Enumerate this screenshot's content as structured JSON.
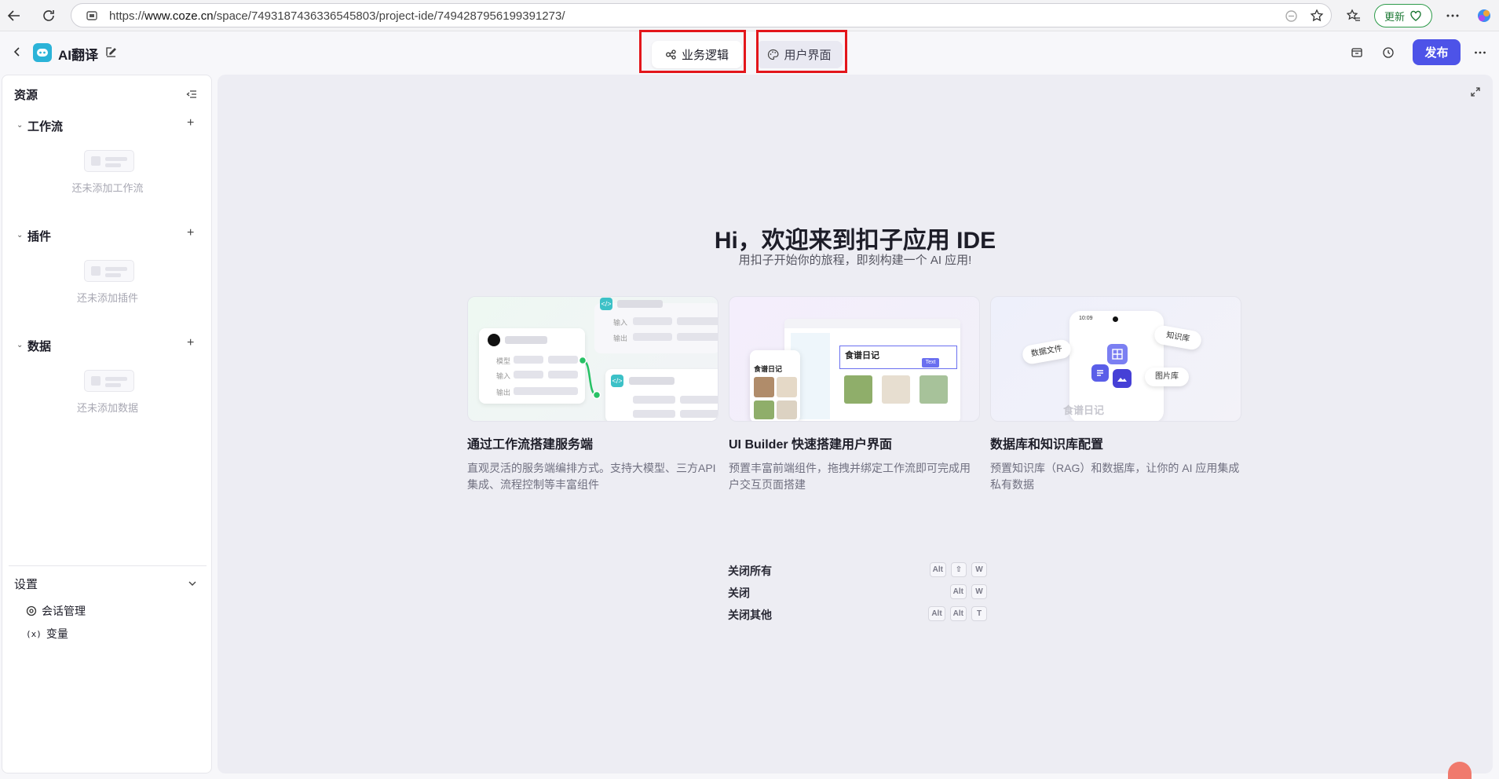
{
  "browser": {
    "url_prefix": "https://",
    "url_host": "www.coze.cn",
    "url_path": "/space/7493187436336545803/project-ide/7494287956199391273/",
    "update_label": "更新"
  },
  "header": {
    "app_title": "AI翻译",
    "tabs": [
      {
        "label": "业务逻辑",
        "active": true
      },
      {
        "label": "用户界面",
        "active": false
      }
    ],
    "publish_label": "发布"
  },
  "sidebar": {
    "title": "资源",
    "sections": [
      {
        "title": "工作流",
        "empty_text": "还未添加工作流"
      },
      {
        "title": "插件",
        "empty_text": "还未添加插件"
      },
      {
        "title": "数据",
        "empty_text": "还未添加数据"
      }
    ],
    "settings": {
      "title": "设置",
      "items": [
        {
          "label": "会话管理",
          "icon": "chat-settings-icon"
        },
        {
          "label": "变量",
          "icon": "variable-icon"
        }
      ]
    }
  },
  "main": {
    "welcome_title": "Hi，欢迎来到扣子应用 IDE",
    "welcome_subtitle": "用扣子开始你的旅程，即刻构建一个 AI 应用!",
    "cards": [
      {
        "title": "通过工作流搭建服务端",
        "desc": "直观灵活的服务端编排方式。支持大模型、三方API集成、流程控制等丰富组件",
        "preview_labels": [
          "输入",
          "输出",
          "模型",
          "输入",
          "输出"
        ]
      },
      {
        "title": "UI Builder 快速搭建用户界面",
        "desc": "预置丰富前端组件，拖拽并绑定工作流即可完成用户交互页面搭建",
        "preview_labels": [
          "食谱日记",
          "食谱日记",
          "Text"
        ]
      },
      {
        "title": "数据库和知识库配置",
        "desc": "预置知识库（RAG）和数据库，让你的 AI 应用集成私有数据",
        "preview_labels": [
          "10:09",
          "知识库",
          "数据文件",
          "图片库",
          "食谱日记"
        ]
      }
    ],
    "shortcuts": [
      {
        "label": "关闭所有",
        "keys": [
          "Alt",
          "⇧",
          "W"
        ]
      },
      {
        "label": "关闭",
        "keys": [
          "Alt",
          "W"
        ]
      },
      {
        "label": "关闭其他",
        "keys": [
          "Alt",
          "Alt",
          "T"
        ]
      }
    ]
  },
  "colors": {
    "accent": "#4d53e8",
    "highlight_box": "#e3161b",
    "update_green": "#2d9b4a"
  }
}
